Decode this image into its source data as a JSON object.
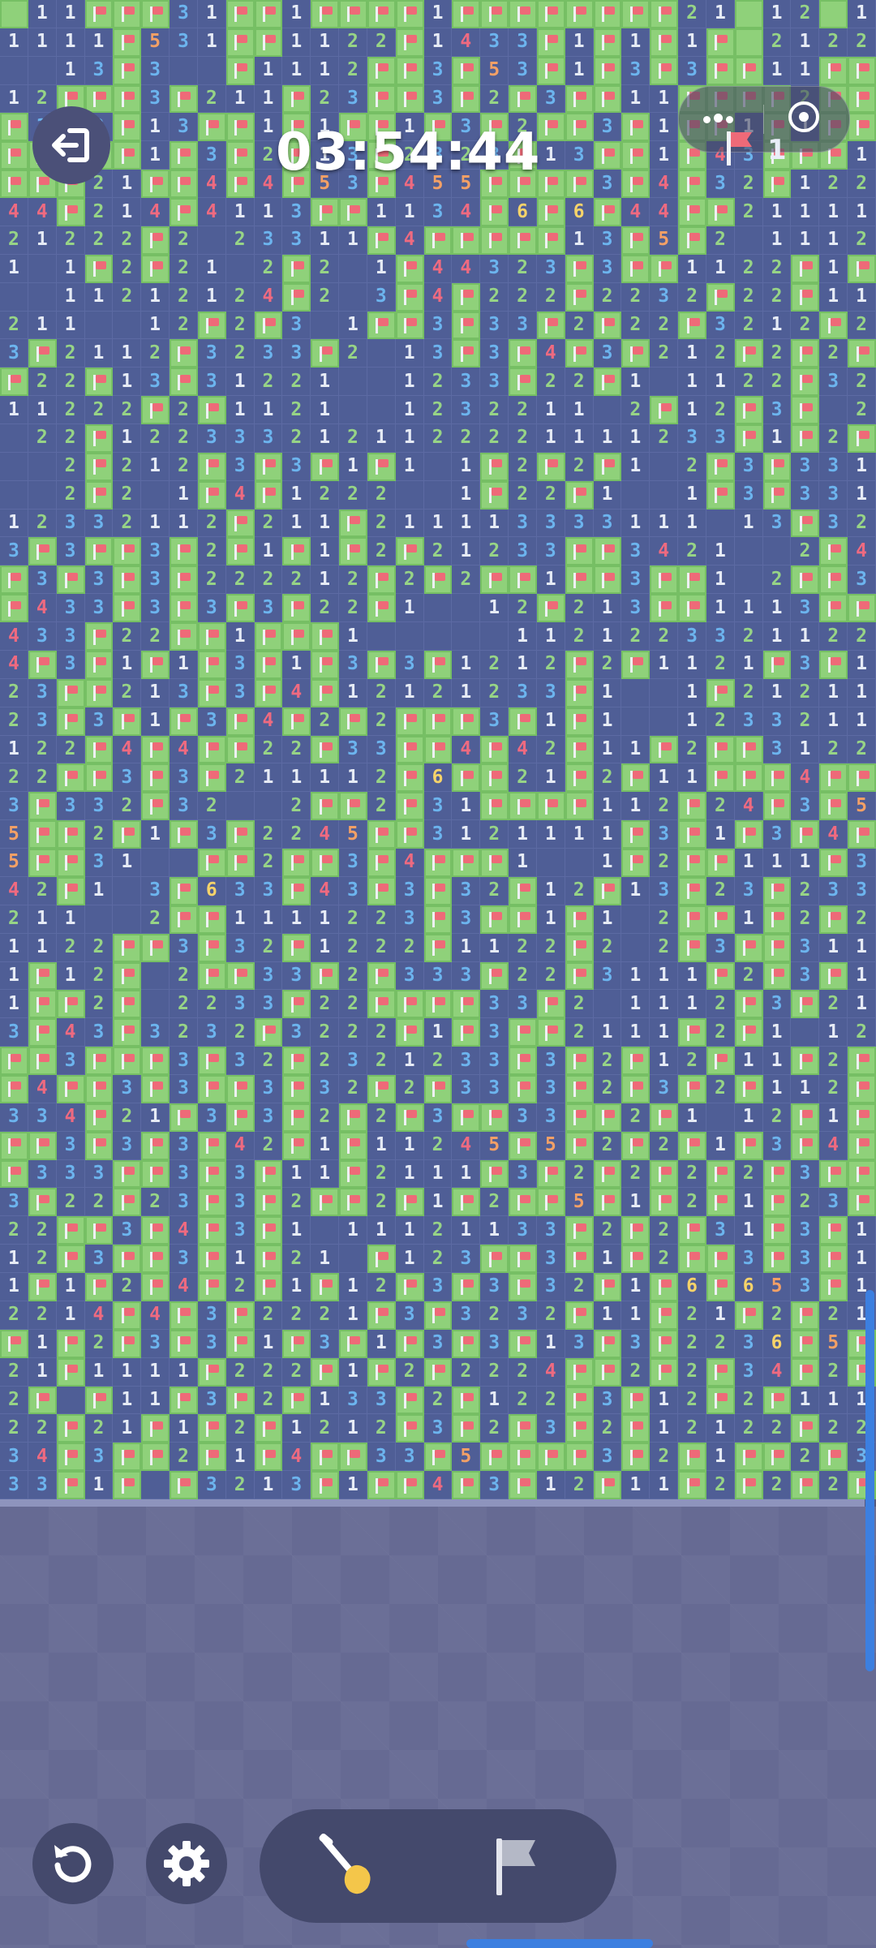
{
  "header": {
    "timer": "03:54:44",
    "flags_remaining": "1"
  },
  "icons": {
    "exit": "exit-icon",
    "more": "more-icon",
    "target": "target-icon",
    "flag_counter": "flag-icon",
    "reset": "reset-icon",
    "settings": "gear-icon",
    "dig": "shovel-icon",
    "flag_mode": "flag-icon"
  },
  "colors": {
    "open_cell": "#4f5e96",
    "hidden_cell": "#8fd17a",
    "flag": "#ee6a78",
    "num1": "#e6ebf5",
    "num2": "#97d486",
    "num3": "#6cb4ee",
    "num4": "#ef6a80",
    "num5": "#f3a066",
    "num6": "#f6d36a"
  },
  "board": {
    "cols": 31,
    "rows": 53,
    "legend": "digit = revealed number, . = revealed empty, F = flagged, H = covered",
    "cells": [
      "H11FFF31FF1FFFF1FFFFFFFF21H12H1",
      "1111F531FF1122F1433F1F1F1FH2122",
      "..13F3..F1112FF3F53F1F3F3FF11FF",
      "12FFF3F211F23FF3F2F3FF11FFFF2FF",
      "F3F3F13FF1F1FF1F3F2FF3F1FF1F1FF",
      "FF3FF1F3F2F13F2323F13FF1F43FFF1",
      "FFF21FF4F4F53F455FFFF3F4F32F122",
      "44F214F4113FF1134F6F6F44FF21111",
      "21222F2.23311F4FFFFF13F5F2.1112",
      "1.1F2F21.2F2.1F44323F3FF1122F1F",
      "..11212124F2.3F4F222F2232F22F11",
      "211..12F2F3.1FF3F33F2F22F3212F2",
      "3F2112F3233F2.13F3F4F3F212F2F2F",
      "F22F13F31221..1233F22F1.1122F32",
      "11222F2F1121..1232211.2F12F3F.2",
      ".22F1223332121122221111233F1F2F",
      "..2F212F3F3F1F1.1F2F2F1.2F3F331",
      "..2F2.1F4F1222..1F22F1..1F3F331",
      "12332112F211F211113333111.13F32",
      "3F3FF3F2F1F1F2F21233FF3421..2F4",
      "F3F3F3F222212F2F2FF1FF3FF1.2FF3",
      "F433F3F3F3F22F1..12F213FF1113FF",
      "433F22FF1FFF1.....1121223321122",
      "4F3F1F1F3F1F3F3F1212F2F1121F3F1",
      "23FF213F3F4F12121233F1..1F21211",
      "23F3F1F3F4F2F2FFF3F1F1..1233211",
      "122F4F4FF22F33FF4F42F11F2FF3122",
      "22FF3F3F211112F6FF21F2F11FFF4FF",
      "3F332F32..2FF2F31FFFF112F24F3F5",
      "5FF2F1F3F2245FF3121111F3F1F3F4F",
      "5FF31..FF2FF3F4FFF1..1F2FF111F3",
      "42F1.3F633F43F3F32F12F13F23F233",
      "211..2FF1111223F3FF1F1.2FF1F2F2",
      "1122FF3F32F1222F1122F2.2F3FF311",
      "1F12F.2FF33F2F333F22F3111F2F3F1",
      "1FF2F.2233F22FFFF33F2.1112F3F21",
      "3F43F3232F3222F1F3FF2111F2F1.12",
      "FF3FFF3F32F2321233F3F2F12F11F2F",
      "F4FF3F3FF3F32F2F33F3F2F3F2F112F",
      "334F21F3F3F2F2F3FF33FF2F1.12F1F",
      "FF3F3F3F42F1F11245F5F2F2F1F3F4F",
      "F333FF3F3F11F2111F3F2F2F2F2F3FF",
      "3F22F23F3F2FF2F1F2FF5F1F2F1F23F",
      "22FF3F4F3F1.11121133F2F2F31F3F1",
      "12F3FF3F1F21.F123FF3F1F2FF3F3F1",
      "1F1F2F4F2F1F12F3F3F32F1F6F653F1",
      "2214F4F3F2221F3F3232F11F21F2F21",
      "F1F2F3F3F1F3F1F3F3F13F3F2236F5F",
      "21F1111F222F1F2F2224FF2F2F34F2F",
      "2F.F11F3F2F133F2F122F3F12F2F111",
      "22F21F1F2F1212F3F2F3F2F12122F22",
      "34F3FF2F1F4FF33F5FFFF3F2F1FF2F3",
      "33F1F.F3213F1FF4F3F12F11F2F2F2F"
    ]
  }
}
